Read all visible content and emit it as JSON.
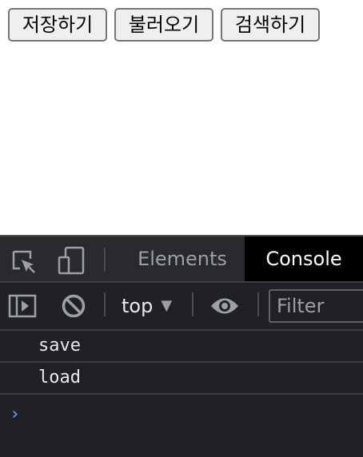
{
  "page": {
    "buttons": [
      {
        "label": "저장하기"
      },
      {
        "label": "불러오기"
      },
      {
        "label": "검색하기"
      }
    ]
  },
  "devtools": {
    "tabs": {
      "elements": "Elements",
      "console": "Console",
      "active": "Console"
    },
    "toolbar": {
      "context": "top",
      "context_arrow": "▼",
      "filter_placeholder": "Filter"
    },
    "console_messages": [
      {
        "text": "save"
      },
      {
        "text": "load"
      }
    ],
    "prompt_symbol": "›",
    "icons": [
      "inspect-element-icon",
      "device-toolbar-icon",
      "show-sidebar-icon",
      "clear-console-icon",
      "live-expression-eye-icon",
      "prompt-chevron-icon"
    ],
    "colors": {
      "panel_bg": "#202124",
      "active_tab_bg": "#000000",
      "prompt_color": "#4f8ff7"
    }
  }
}
